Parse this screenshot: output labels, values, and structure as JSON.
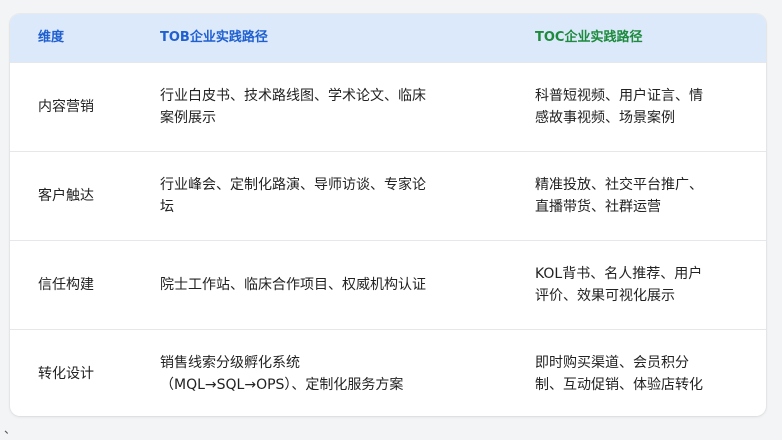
{
  "table": {
    "headers": [
      "维度",
      "TOB企业实践路径",
      "TOC企业实践路径"
    ],
    "header_colors": [
      "#1f5fcf",
      "#1f5fcf",
      "#1d8a3c"
    ],
    "rows": [
      {
        "dimension": "内容营销",
        "tob": [
          "行业白皮书、技术路线图、学术论文、临床",
          "案例展示"
        ],
        "toc": [
          "科普短视频、用户证言、情",
          "感故事视频、场景案例"
        ]
      },
      {
        "dimension": "客户触达",
        "tob": [
          "行业峰会、定制化路演、导师访谈、专家论",
          "坛"
        ],
        "toc": [
          "精准投放、社交平台推广、",
          "直播带货、社群运营"
        ]
      },
      {
        "dimension": "信任构建",
        "tob": [
          "院士工作站、临床合作项目、权威机构认证"
        ],
        "toc": [
          "KOL背书、名人推荐、用户",
          "评价、效果可视化展示"
        ]
      },
      {
        "dimension": "转化设计",
        "tob": [
          "销售线索分级孵化系统",
          "（MQL→SQL→OPS）、定制化服务方案"
        ],
        "toc": [
          "即时购买渠道、会员积分",
          "制、互动促销、体验店转化"
        ]
      }
    ]
  },
  "stray_mark": "、"
}
